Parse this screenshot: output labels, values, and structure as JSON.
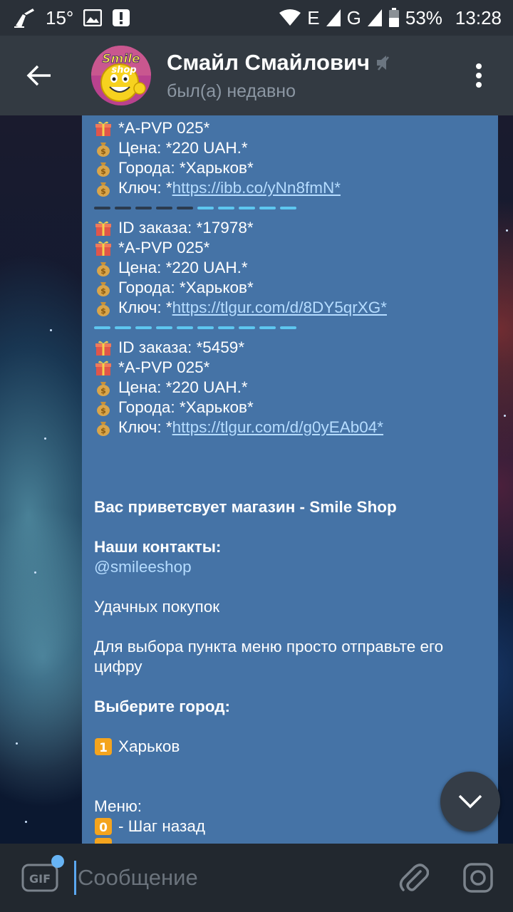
{
  "status_bar": {
    "temperature": "15°",
    "battery": "53%",
    "time": "13:28",
    "network_1": "E",
    "network_2": "G"
  },
  "header": {
    "title": "Смайл Смайлович",
    "subtitle": "был(а) недавно",
    "avatar_text": "SmileShop"
  },
  "messages": {
    "order1": {
      "product": "*A-PVP 025*",
      "price": "Цена: *220 UAH.*",
      "city": "Города: *Харьков*",
      "key_label": "Ключ: *",
      "key_link": "https://ibb.co/yNn8fmN*"
    },
    "order2": {
      "id": "ID заказа: *17978*",
      "product": "*A-PVP 025*",
      "price": "Цена: *220 UAH.*",
      "city": "Города: *Харьков*",
      "key_label": "Ключ: *",
      "key_link": "https://tlgur.com/d/8DY5qrXG*"
    },
    "order3": {
      "id": "ID заказа: *5459*",
      "product": "*A-PVP 025*",
      "price": "Цена: *220 UAH.*",
      "city": "Города: *Харьков*",
      "key_label": "Ключ: *",
      "key_link": "https://tlgur.com/d/g0yEAb04*"
    },
    "welcome": "Вас приветсвует магазин - Smile Shop",
    "contacts_label": "Наши контакты:",
    "contacts_handle": "@smileeshop",
    "good_luck": "Удачных покупок",
    "instruction": "Для выбора пункта меню просто отправьте его цифру",
    "choose_city": "Выберите город:",
    "city_option_num": "1",
    "city_option": "Харьков",
    "menu_label": "Меню:",
    "menu_option_num": "0",
    "menu_option": "- Шаг назад"
  },
  "input": {
    "placeholder": "Сообщение",
    "gif_label": "GIF"
  },
  "colors": {
    "bubble": "#4573a6",
    "header": "#333a42",
    "statusbar": "#2a3038",
    "inputbar": "#22282f",
    "link": "#b5dcff",
    "accent": "#5ec7ef"
  }
}
